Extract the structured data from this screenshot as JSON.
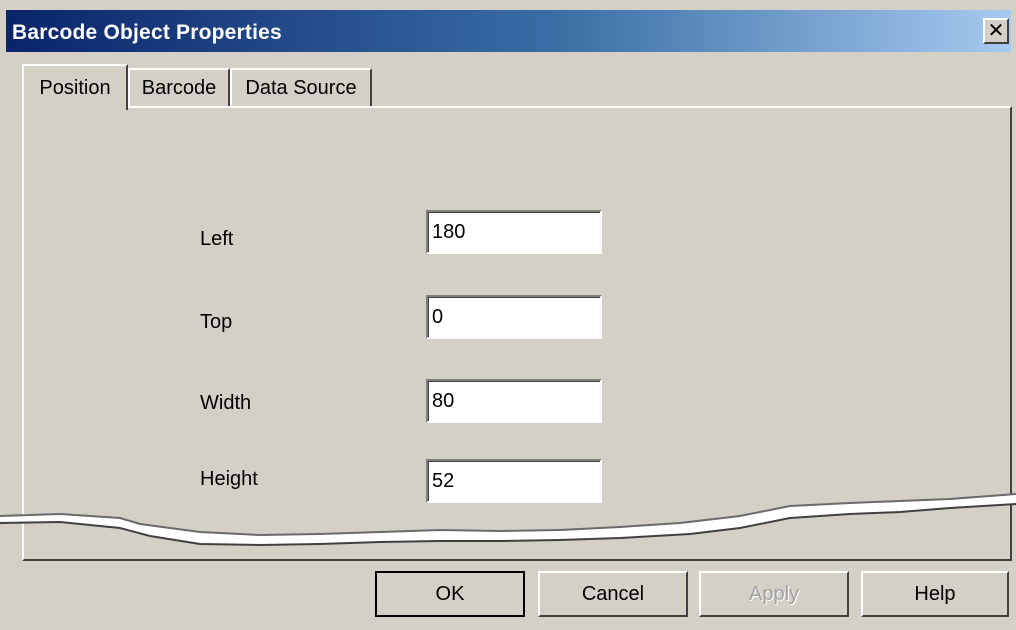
{
  "window": {
    "title": "Barcode Object Properties",
    "close_glyph": "✕"
  },
  "tabs": [
    {
      "label": "Position",
      "active": true
    },
    {
      "label": "Barcode",
      "active": false
    },
    {
      "label": "Data Source",
      "active": false
    }
  ],
  "position": {
    "fields": [
      {
        "label": "Left",
        "value": "180"
      },
      {
        "label": "Top",
        "value": "0"
      },
      {
        "label": "Width",
        "value": "80"
      },
      {
        "label": "Height",
        "value": "52"
      }
    ]
  },
  "buttons": {
    "ok": "OK",
    "cancel": "Cancel",
    "apply": "Apply",
    "help": "Help"
  },
  "colors": {
    "titlebar_start": "#0a246a",
    "titlebar_end": "#a6caf0",
    "face": "#d4d0c8"
  }
}
